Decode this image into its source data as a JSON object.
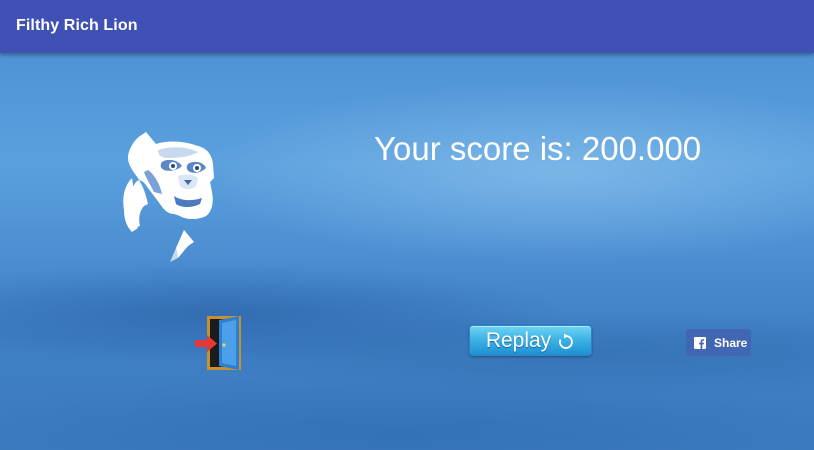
{
  "app": {
    "title": "Filthy Rich Lion",
    "colors": {
      "app_bar": "#3f51b5",
      "background": "#4a8fd4",
      "facebook": "#4267b2"
    }
  },
  "game": {
    "score_text": "Your score is: 200.000",
    "logo_icon": "lion-head-icon",
    "exit_icon": "exit-door-icon",
    "replay_label": "Replay",
    "replay_icon": "refresh-icon",
    "share_label": "Share",
    "share_icon": "facebook-icon"
  }
}
